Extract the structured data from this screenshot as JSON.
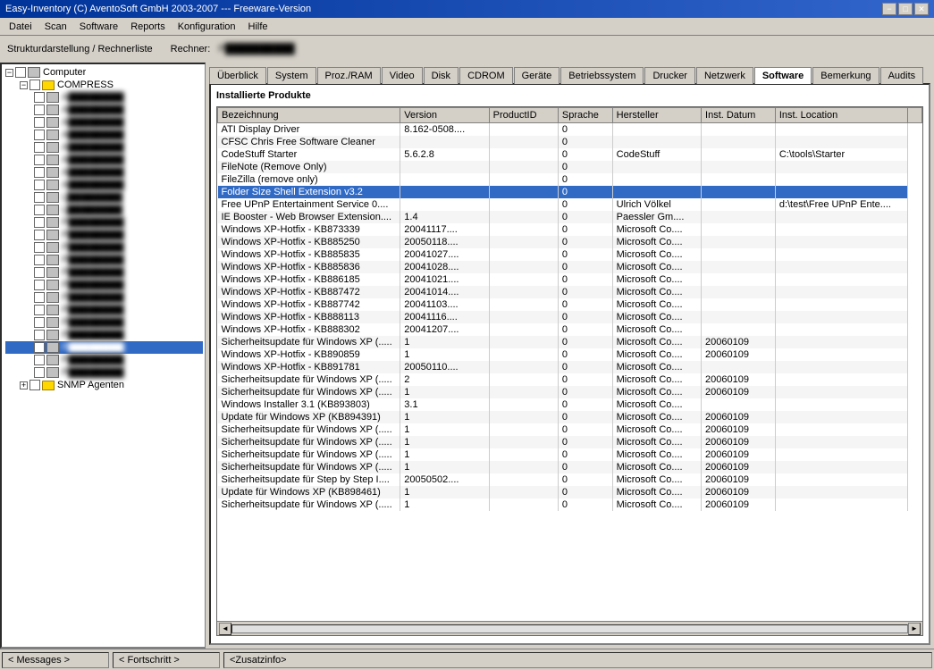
{
  "titleBar": {
    "title": "Easy-Inventory (C) AventoSoft GmbH 2003-2007 --- Freeware-Version",
    "minBtn": "−",
    "maxBtn": "□",
    "closeBtn": "✕"
  },
  "menuBar": {
    "items": [
      "Datei",
      "Scan",
      "Software",
      "Reports",
      "Konfiguration",
      "Hilfe"
    ]
  },
  "toolbar": {
    "structureLabel": "Strukturdarstellung / Rechnerliste",
    "computerLabel": "Rechner:",
    "computerName": "P██████████"
  },
  "tree": {
    "rootLabel": "Computer",
    "compressLabel": "COMPRESS",
    "snmpLabel": "SNMP Agenten",
    "items": [
      {
        "label": "A████████",
        "indent": 2
      },
      {
        "label": "A████████",
        "indent": 2
      },
      {
        "label": "A████████",
        "indent": 2
      },
      {
        "label": "A████████",
        "indent": 2
      },
      {
        "label": "A████████",
        "indent": 2
      },
      {
        "label": "A████████",
        "indent": 2
      },
      {
        "label": "A████████",
        "indent": 2
      },
      {
        "label": "A████████",
        "indent": 2
      },
      {
        "label": "L████████",
        "indent": 2
      },
      {
        "label": "L████████",
        "indent": 2
      },
      {
        "label": "P████████",
        "indent": 2
      },
      {
        "label": "P████████",
        "indent": 2
      },
      {
        "label": "P████████",
        "indent": 2
      },
      {
        "label": "P████████",
        "indent": 2
      },
      {
        "label": "P████████",
        "indent": 2
      },
      {
        "label": "P████████",
        "indent": 2
      },
      {
        "label": "P████████",
        "indent": 2
      },
      {
        "label": "P████████",
        "indent": 2
      },
      {
        "label": "P████████",
        "indent": 2
      },
      {
        "label": "P████████",
        "indent": 2
      },
      {
        "label": "P████████",
        "indent": 2
      },
      {
        "label": "P████████",
        "indent": 2
      },
      {
        "label": "P████████",
        "indent": 2
      }
    ]
  },
  "tabs": [
    {
      "label": "Überblick",
      "active": false
    },
    {
      "label": "System",
      "active": false
    },
    {
      "label": "Proz./RAM",
      "active": false
    },
    {
      "label": "Video",
      "active": false
    },
    {
      "label": "Disk",
      "active": false
    },
    {
      "label": "CDROM",
      "active": false
    },
    {
      "label": "Geräte",
      "active": false
    },
    {
      "label": "Betriebssystem",
      "active": false
    },
    {
      "label": "Drucker",
      "active": false
    },
    {
      "label": "Netzwerk",
      "active": false
    },
    {
      "label": "Software",
      "active": true
    },
    {
      "label": "Bemerkung",
      "active": false
    },
    {
      "label": "Audits",
      "active": false
    }
  ],
  "installedProducts": {
    "sectionTitle": "Installierte Produkte",
    "columns": [
      "Bezeichnung",
      "Version",
      "ProductID",
      "Sprache",
      "Hersteller",
      "Inst. Datum",
      "Inst. Location"
    ],
    "rows": [
      {
        "bezeichnung": "ATI Display Driver",
        "version": "8.162-0508....",
        "productid": "",
        "sprache": "0",
        "hersteller": "",
        "instDatum": "",
        "instLocation": ""
      },
      {
        "bezeichnung": "CFSC Chris Free Software Cleaner",
        "version": "",
        "productid": "",
        "sprache": "0",
        "hersteller": "",
        "instDatum": "",
        "instLocation": ""
      },
      {
        "bezeichnung": "CodeStuff Starter",
        "version": "5.6.2.8",
        "productid": "",
        "sprache": "0",
        "hersteller": "CodeStuff",
        "instDatum": "",
        "instLocation": "C:\\tools\\Starter"
      },
      {
        "bezeichnung": "FileNote (Remove Only)",
        "version": "",
        "productid": "",
        "sprache": "0",
        "hersteller": "",
        "instDatum": "",
        "instLocation": ""
      },
      {
        "bezeichnung": "FileZilla (remove only)",
        "version": "",
        "productid": "",
        "sprache": "0",
        "hersteller": "",
        "instDatum": "",
        "instLocation": ""
      },
      {
        "bezeichnung": "Folder Size Shell Extension v3.2",
        "version": "",
        "productid": "",
        "sprache": "0",
        "hersteller": "",
        "instDatum": "",
        "instLocation": "",
        "selected": true
      },
      {
        "bezeichnung": "Free UPnP Entertainment Service 0....",
        "version": "",
        "productid": "",
        "sprache": "0",
        "hersteller": "Ulrich Völkel",
        "instDatum": "",
        "instLocation": "d:\\test\\Free UPnP Ente...."
      },
      {
        "bezeichnung": "IE Booster - Web Browser Extension....",
        "version": "1.4",
        "productid": "",
        "sprache": "0",
        "hersteller": "Paessler Gm....",
        "instDatum": "",
        "instLocation": ""
      },
      {
        "bezeichnung": "Windows XP-Hotfix - KB873339",
        "version": "20041117....",
        "productid": "",
        "sprache": "0",
        "hersteller": "Microsoft Co....",
        "instDatum": "",
        "instLocation": ""
      },
      {
        "bezeichnung": "Windows XP-Hotfix - KB885250",
        "version": "20050118....",
        "productid": "",
        "sprache": "0",
        "hersteller": "Microsoft Co....",
        "instDatum": "",
        "instLocation": ""
      },
      {
        "bezeichnung": "Windows XP-Hotfix - KB885835",
        "version": "20041027....",
        "productid": "",
        "sprache": "0",
        "hersteller": "Microsoft Co....",
        "instDatum": "",
        "instLocation": ""
      },
      {
        "bezeichnung": "Windows XP-Hotfix - KB885836",
        "version": "20041028....",
        "productid": "",
        "sprache": "0",
        "hersteller": "Microsoft Co....",
        "instDatum": "",
        "instLocation": ""
      },
      {
        "bezeichnung": "Windows XP-Hotfix - KB886185",
        "version": "20041021....",
        "productid": "",
        "sprache": "0",
        "hersteller": "Microsoft Co....",
        "instDatum": "",
        "instLocation": ""
      },
      {
        "bezeichnung": "Windows XP-Hotfix - KB887472",
        "version": "20041014....",
        "productid": "",
        "sprache": "0",
        "hersteller": "Microsoft Co....",
        "instDatum": "",
        "instLocation": ""
      },
      {
        "bezeichnung": "Windows XP-Hotfix - KB887742",
        "version": "20041103....",
        "productid": "",
        "sprache": "0",
        "hersteller": "Microsoft Co....",
        "instDatum": "",
        "instLocation": ""
      },
      {
        "bezeichnung": "Windows XP-Hotfix - KB888113",
        "version": "20041116....",
        "productid": "",
        "sprache": "0",
        "hersteller": "Microsoft Co....",
        "instDatum": "",
        "instLocation": ""
      },
      {
        "bezeichnung": "Windows XP-Hotfix - KB888302",
        "version": "20041207....",
        "productid": "",
        "sprache": "0",
        "hersteller": "Microsoft Co....",
        "instDatum": "",
        "instLocation": ""
      },
      {
        "bezeichnung": "Sicherheitsupdate für Windows XP (.....",
        "version": "1",
        "productid": "",
        "sprache": "0",
        "hersteller": "Microsoft Co....",
        "instDatum": "20060109",
        "instLocation": ""
      },
      {
        "bezeichnung": "Windows XP-Hotfix - KB890859",
        "version": "1",
        "productid": "",
        "sprache": "0",
        "hersteller": "Microsoft Co....",
        "instDatum": "20060109",
        "instLocation": ""
      },
      {
        "bezeichnung": "Windows XP-Hotfix - KB891781",
        "version": "20050110....",
        "productid": "",
        "sprache": "0",
        "hersteller": "Microsoft Co....",
        "instDatum": "",
        "instLocation": ""
      },
      {
        "bezeichnung": "Sicherheitsupdate für Windows XP (.....",
        "version": "2",
        "productid": "",
        "sprache": "0",
        "hersteller": "Microsoft Co....",
        "instDatum": "20060109",
        "instLocation": ""
      },
      {
        "bezeichnung": "Sicherheitsupdate für Windows XP (.....",
        "version": "1",
        "productid": "",
        "sprache": "0",
        "hersteller": "Microsoft Co....",
        "instDatum": "20060109",
        "instLocation": ""
      },
      {
        "bezeichnung": "Windows Installer 3.1 (KB893803)",
        "version": "3.1",
        "productid": "",
        "sprache": "0",
        "hersteller": "Microsoft Co....",
        "instDatum": "",
        "instLocation": ""
      },
      {
        "bezeichnung": "Update für Windows XP (KB894391)",
        "version": "1",
        "productid": "",
        "sprache": "0",
        "hersteller": "Microsoft Co....",
        "instDatum": "20060109",
        "instLocation": ""
      },
      {
        "bezeichnung": "Sicherheitsupdate für Windows XP (.....",
        "version": "1",
        "productid": "",
        "sprache": "0",
        "hersteller": "Microsoft Co....",
        "instDatum": "20060109",
        "instLocation": ""
      },
      {
        "bezeichnung": "Sicherheitsupdate für Windows XP (.....",
        "version": "1",
        "productid": "",
        "sprache": "0",
        "hersteller": "Microsoft Co....",
        "instDatum": "20060109",
        "instLocation": ""
      },
      {
        "bezeichnung": "Sicherheitsupdate für Windows XP (.....",
        "version": "1",
        "productid": "",
        "sprache": "0",
        "hersteller": "Microsoft Co....",
        "instDatum": "20060109",
        "instLocation": ""
      },
      {
        "bezeichnung": "Sicherheitsupdate für Windows XP (.....",
        "version": "1",
        "productid": "",
        "sprache": "0",
        "hersteller": "Microsoft Co....",
        "instDatum": "20060109",
        "instLocation": ""
      },
      {
        "bezeichnung": "Sicherheitsupdate für Step by Step I....",
        "version": "20050502....",
        "productid": "",
        "sprache": "0",
        "hersteller": "Microsoft Co....",
        "instDatum": "20060109",
        "instLocation": ""
      },
      {
        "bezeichnung": "Update für Windows XP (KB898461)",
        "version": "1",
        "productid": "",
        "sprache": "0",
        "hersteller": "Microsoft Co....",
        "instDatum": "20060109",
        "instLocation": ""
      },
      {
        "bezeichnung": "Sicherheitsupdate für Windows XP (.....",
        "version": "1",
        "productid": "",
        "sprache": "0",
        "hersteller": "Microsoft Co....",
        "instDatum": "20060109",
        "instLocation": ""
      }
    ]
  },
  "statusBar": {
    "messages": "< Messages >",
    "fortschritt": "< Fortschritt >",
    "zusatzinfo": "<Zusatzinfo>"
  }
}
